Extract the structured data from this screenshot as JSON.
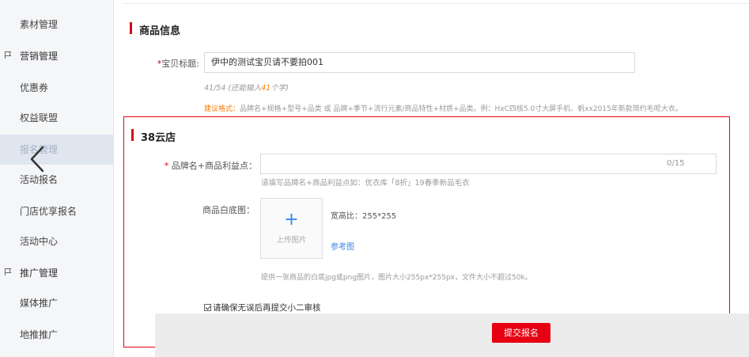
{
  "sidebar": {
    "items": [
      {
        "label": "素材管理",
        "kind": "sub"
      },
      {
        "label": "营销管理",
        "kind": "group",
        "icon": "flag-icon"
      },
      {
        "label": "优惠券",
        "kind": "sub"
      },
      {
        "label": "权益联盟",
        "kind": "sub"
      },
      {
        "label": "报名管理",
        "kind": "sub",
        "active": true
      },
      {
        "label": "活动报名",
        "kind": "sub"
      },
      {
        "label": "门店优享报名",
        "kind": "sub"
      },
      {
        "label": "活动中心",
        "kind": "sub"
      },
      {
        "label": "推广管理",
        "kind": "group",
        "icon": "flag-icon"
      },
      {
        "label": "媒体推广",
        "kind": "sub"
      },
      {
        "label": "地推推广",
        "kind": "sub"
      }
    ]
  },
  "product_info": {
    "title": "商品信息",
    "title_label_req": "*",
    "title_label": "宝贝标题:",
    "title_value": "伊中的测试宝贝请不要拍001",
    "count_hint_prefix": "41/54 (还能输入",
    "count_hint_number": "41",
    "count_hint_suffix": "个字)",
    "suggest_label": "建议格式：",
    "suggest_text": "品牌名+规格+型号+品类 或 品牌+季节+流行元素/商品特性+材质+品类。例：HxC四核5.0寸大屏手机、帆xx2015年新款简约毛呢大衣。"
  },
  "store": {
    "title": "38云店",
    "brand_label_req": "*",
    "brand_label": "品牌名+商品利益点：",
    "brand_counter": "0/15",
    "brand_hint": "请填写品牌名+商品利益点如：优衣库「8折」19春季新品毛衣",
    "image_label": "商品白底图：",
    "upload_plus": "+",
    "upload_text": "上传图片",
    "ratio_text": "宽高比：255*255",
    "ref_link": "参考图",
    "image_desc": "提供一张商品的白底jpg或png图片，图片大小255px*255px，文件大小不超过50k。",
    "confirm_text": "请确保无误后再提交小二审核",
    "submit_label": "提交报名"
  },
  "colors": {
    "accent_red": "#e60012",
    "link_blue": "#3a86e8",
    "hint_orange": "#ff7a00"
  }
}
